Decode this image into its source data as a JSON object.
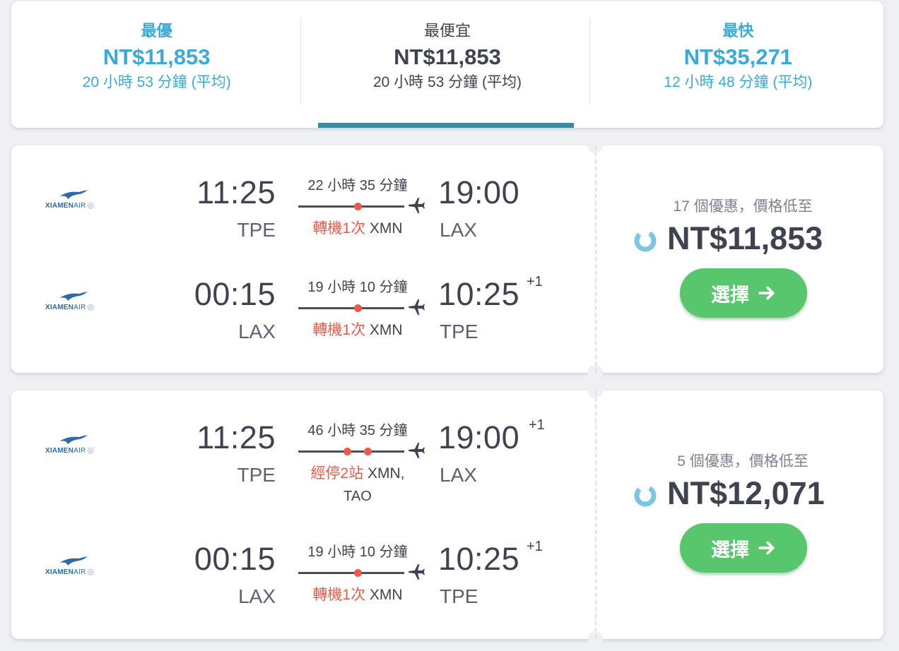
{
  "sort_tabs": [
    {
      "label": "最優",
      "price": "NT$11,853",
      "duration": "20 小時 53 分鐘 (平均)"
    },
    {
      "label": "最便宜",
      "price": "NT$11,853",
      "duration": "20 小時 53 分鐘 (平均)"
    },
    {
      "label": "最快",
      "price": "NT$35,271",
      "duration": "12 小時 48 分鐘 (平均)"
    }
  ],
  "active_tab": "最便宜",
  "colors": {
    "teal": "#3aaad8",
    "active_bar": "#3c8aa2",
    "stop_red": "#ef5848",
    "select_green": "#58c66c"
  },
  "airline": {
    "logo_name": "XIAMEN",
    "logo_suffix": "AIR"
  },
  "results": [
    {
      "deals": "17 個優惠，價格低至",
      "price": "NT$11,853",
      "select_label": "選擇",
      "legs": [
        {
          "dep_time": "11:25",
          "dep_airport": "TPE",
          "duration": "22 小時 35 分鐘",
          "stops_label": "轉機1次",
          "stops_airports": "XMN",
          "stops_airports_2": "",
          "arr_time": "19:00",
          "arr_day": "",
          "arr_airport": "LAX"
        },
        {
          "dep_time": "00:15",
          "dep_airport": "LAX",
          "duration": "19 小時 10 分鐘",
          "stops_label": "轉機1次",
          "stops_airports": "XMN",
          "stops_airports_2": "",
          "arr_time": "10:25",
          "arr_day": "+1",
          "arr_airport": "TPE"
        }
      ]
    },
    {
      "deals": "5 個優惠，價格低至",
      "price": "NT$12,071",
      "select_label": "選擇",
      "legs": [
        {
          "dep_time": "11:25",
          "dep_airport": "TPE",
          "duration": "46 小時 35 分鐘",
          "stops_label": "經停2站",
          "stops_airports": "XMN,",
          "stops_airports_2": "TAO",
          "arr_time": "19:00",
          "arr_day": "+1",
          "arr_airport": "LAX"
        },
        {
          "dep_time": "00:15",
          "dep_airport": "LAX",
          "duration": "19 小時 10 分鐘",
          "stops_label": "轉機1次",
          "stops_airports": "XMN",
          "stops_airports_2": "",
          "arr_time": "10:25",
          "arr_day": "+1",
          "arr_airport": "TPE"
        }
      ]
    }
  ]
}
